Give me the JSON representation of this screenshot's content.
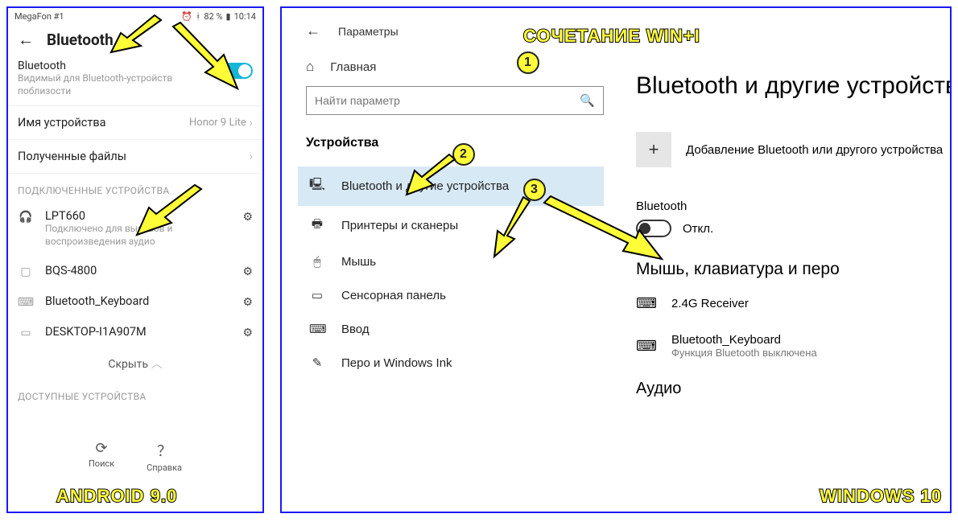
{
  "android": {
    "statusbar": {
      "carrier": "MegaFon #1",
      "battery": "82 %",
      "time": "10:14"
    },
    "title": "Bluetooth",
    "bt": {
      "title": "Bluetooth",
      "sub": "Видимый для Bluetooth-устройств поблизости"
    },
    "device_name_row": {
      "label": "Имя устройства",
      "value": "Honor 9 Lite"
    },
    "received_row": {
      "label": "Полученные файлы"
    },
    "connected_label": "ПОДКЛЮЧЕННЫЕ УСТРОЙСТВА",
    "devices": [
      {
        "name": "LPT660",
        "sub": "Подключено для вызовов и воспроизведения аудио",
        "icon": "headphones"
      },
      {
        "name": "BQS-4800",
        "sub": "",
        "icon": "phone"
      },
      {
        "name": "Bluetooth_Keyboard",
        "sub": "",
        "icon": "keyboard"
      },
      {
        "name": "DESKTOP-I1A907M",
        "sub": "",
        "icon": "laptop"
      }
    ],
    "hide": "Скрыть",
    "available_label": "ДОСТУПНЫЕ УСТРОЙСТВА",
    "bottom": {
      "search": "Поиск",
      "help": "Справка"
    },
    "caption": "ANDROID 9.0"
  },
  "windows": {
    "header": "Параметры",
    "home": "Главная",
    "search_placeholder": "Найти параметр",
    "section": "Устройства",
    "menu": [
      {
        "label": "Bluetooth и другие устройства",
        "icon": "bt"
      },
      {
        "label": "Принтеры и сканеры",
        "icon": "printer"
      },
      {
        "label": "Мышь",
        "icon": "mouse"
      },
      {
        "label": "Сенсорная панель",
        "icon": "touchpad"
      },
      {
        "label": "Ввод",
        "icon": "keyboard"
      },
      {
        "label": "Перо и Windows Ink",
        "icon": "pen"
      }
    ],
    "page_title": "Bluetooth и другие устройства",
    "add": "Добавление Bluetooth или другого устройства",
    "bt_label": "Bluetooth",
    "bt_state": "Откл.",
    "mkp_header": "Мышь, клавиатура и перо",
    "devs": [
      {
        "name": "2.4G Receiver",
        "sub": ""
      },
      {
        "name": "Bluetooth_Keyboard",
        "sub": "Функция Bluetooth выключена"
      }
    ],
    "audio_header": "Аудио",
    "caption": "WINDOWS 10"
  },
  "annotations": {
    "top_text": "СОЧЕТАНИЕ WIN+I",
    "n1": "1",
    "n2": "2",
    "n3": "3"
  }
}
